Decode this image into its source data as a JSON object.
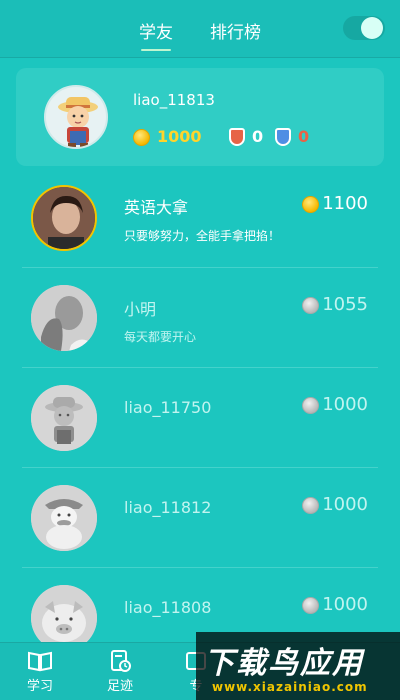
{
  "header": {
    "tabs": [
      {
        "label": "学友",
        "active": true
      },
      {
        "label": "排行榜",
        "active": false
      }
    ],
    "toggle_on": true
  },
  "me": {
    "name": "liao_11813",
    "coins": "1000",
    "badge_red_count": "0",
    "badge_blue_count": "0"
  },
  "friends": [
    {
      "name": "英语大拿",
      "motto": "只要够努力，全能手拿把掐！",
      "coins": "1100",
      "coin_color": "gold",
      "avatar_icon": "man-photo-avatar"
    },
    {
      "name": "小明",
      "motto": "每天都要开心",
      "coins": "1055",
      "coin_color": "silver",
      "avatar_icon": "hand-face-photo-avatar"
    },
    {
      "name": "liao_11750",
      "motto": "",
      "coins": "1000",
      "coin_color": "silver",
      "avatar_icon": "farmer-avatar"
    },
    {
      "name": "liao_11812",
      "motto": "",
      "coins": "1000",
      "coin_color": "silver",
      "avatar_icon": "duck-avatar"
    },
    {
      "name": "liao_11808",
      "motto": "",
      "coins": "1000",
      "coin_color": "silver",
      "avatar_icon": "pig-avatar"
    }
  ],
  "bottom_nav": [
    {
      "label": "学习",
      "icon": "book-icon"
    },
    {
      "label": "足迹",
      "icon": "footprint-clock-icon"
    },
    {
      "label": "专",
      "icon": "special-icon"
    }
  ],
  "watermark": {
    "title": "下载鸟应用",
    "url": "www.xiazainiao.com"
  },
  "colors": {
    "background": "#1cc6bf",
    "gold": "#ffd42a",
    "red_badge": "#e76447",
    "blue_badge": "#4f8ee4"
  }
}
